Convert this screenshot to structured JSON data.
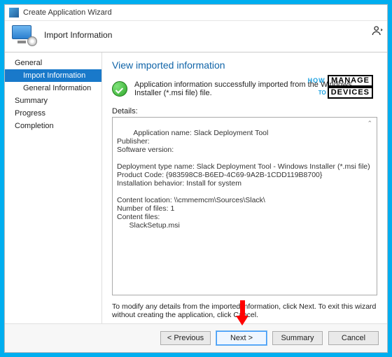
{
  "window": {
    "title": "Create Application Wizard"
  },
  "header": {
    "label": "Import Information"
  },
  "sidebar": {
    "items": [
      {
        "label": "General",
        "selected": false,
        "sub": false
      },
      {
        "label": "Import Information",
        "selected": true,
        "sub": true
      },
      {
        "label": "General Information",
        "selected": false,
        "sub": true
      },
      {
        "label": "Summary",
        "selected": false,
        "sub": false
      },
      {
        "label": "Progress",
        "selected": false,
        "sub": false
      },
      {
        "label": "Completion",
        "selected": false,
        "sub": false
      }
    ]
  },
  "main": {
    "title": "View imported information",
    "success_text": "Application information successfully imported from the Windows Installer (*.msi file) file.",
    "details_label": "Details:",
    "details_text": "Application name: Slack Deployment Tool\nPublisher:\nSoftware version:\n\nDeployment type name: Slack Deployment Tool - Windows Installer (*.msi file)\nProduct Code: {983598C8-B6ED-4C69-9A2B-1CDD119B8700}\nInstallation behavior: Install for system\n\nContent location: \\\\cmmemcm\\Sources\\Slack\\\nNumber of files: 1\nContent files:\n      SlackSetup.msi",
    "hint": "To modify any details from the imported information, click Next. To exit this wizard without creating the application, click Cancel."
  },
  "watermark": {
    "line1": "HOW",
    "box1": "MANAGE",
    "line2": "TO",
    "box2": "DEVICES"
  },
  "buttons": {
    "previous": "< Previous",
    "next": "Next >",
    "summary": "Summary",
    "cancel": "Cancel"
  }
}
